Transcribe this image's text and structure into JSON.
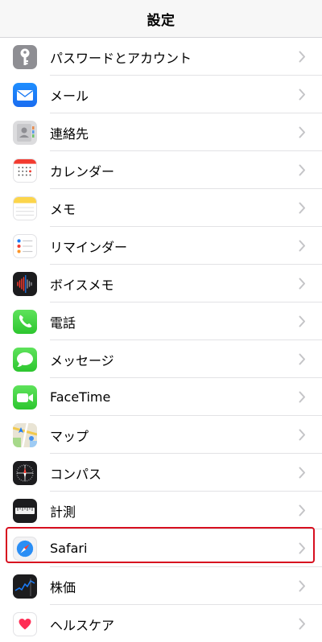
{
  "nav": {
    "title": "設定"
  },
  "rows": [
    {
      "label": "パスワードとアカウント",
      "icon": "key-icon"
    },
    {
      "label": "メール",
      "icon": "mail-icon"
    },
    {
      "label": "連絡先",
      "icon": "contacts-icon"
    },
    {
      "label": "カレンダー",
      "icon": "calendar-icon"
    },
    {
      "label": "メモ",
      "icon": "notes-icon"
    },
    {
      "label": "リマインダー",
      "icon": "reminders-icon"
    },
    {
      "label": "ボイスメモ",
      "icon": "voice-memos-icon"
    },
    {
      "label": "電話",
      "icon": "phone-icon"
    },
    {
      "label": "メッセージ",
      "icon": "messages-icon"
    },
    {
      "label": "FaceTime",
      "icon": "facetime-icon"
    },
    {
      "label": "マップ",
      "icon": "maps-icon"
    },
    {
      "label": "コンパス",
      "icon": "compass-icon"
    },
    {
      "label": "計測",
      "icon": "measure-icon"
    },
    {
      "label": "Safari",
      "icon": "safari-icon",
      "highlighted": true
    },
    {
      "label": "株価",
      "icon": "stocks-icon"
    },
    {
      "label": "ヘルスケア",
      "icon": "health-icon"
    }
  ],
  "colors": {
    "highlight": "#d70f1f",
    "chevron": "#c4c4c7"
  }
}
